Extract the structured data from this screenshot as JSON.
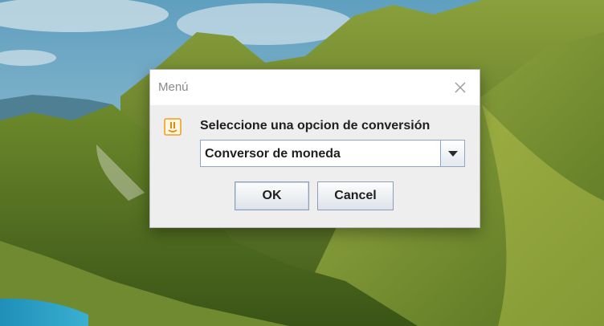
{
  "dialog": {
    "title": "Menú",
    "close_icon": "close-icon",
    "message_icon": "info-icon",
    "prompt": "Seleccione una opcion de conversión",
    "select": {
      "selected": "Conversor de moneda",
      "arrow_icon": "triangle-down-icon"
    },
    "buttons": {
      "ok": "OK",
      "cancel": "Cancel"
    }
  },
  "colors": {
    "dialog_background": "#eeeeee",
    "titlebar_background": "#ffffff",
    "title_text": "#8a8a8a",
    "combo_border": "#8fa6c4",
    "icon_accent": "#f0a020"
  }
}
